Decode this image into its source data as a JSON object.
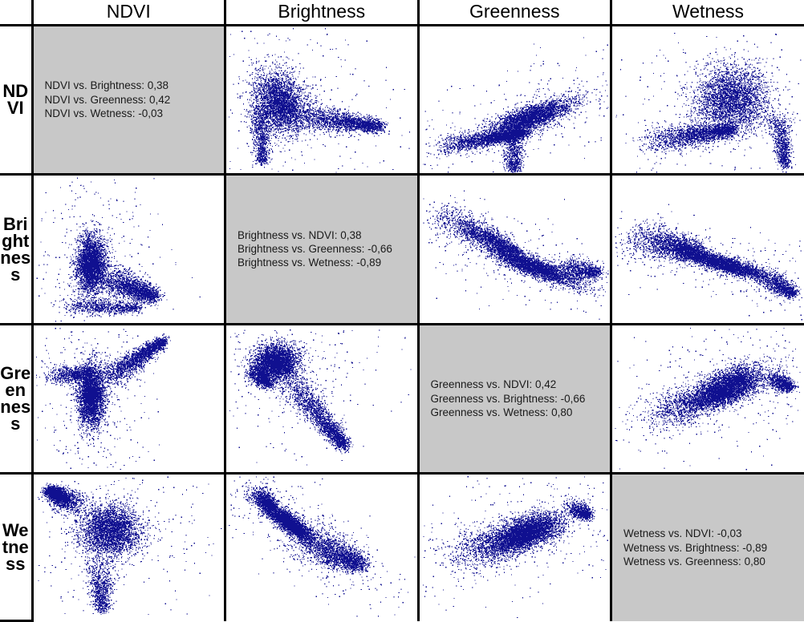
{
  "variables": [
    "NDVI",
    "Brightness",
    "Greenness",
    "Wetness"
  ],
  "column_headers": [
    {
      "label": "NDVI"
    },
    {
      "label": "Brightness"
    },
    {
      "label": "Greenness"
    },
    {
      "label": "Wetness"
    }
  ],
  "row_headers": [
    {
      "label": "NDVI"
    },
    {
      "label": "Brightness"
    },
    {
      "label": "Greenness"
    },
    {
      "label": "Wetness"
    }
  ],
  "colors": {
    "point": "#101090",
    "diagonal_background": "#c8c8c8",
    "cell_background": "#ffffff",
    "grid_line": "#000000",
    "text": "#1a1a1a",
    "stray_point": "#ff00ff"
  },
  "diagonal_panels": [
    {
      "variable": "NDVI",
      "lines": [
        "NDVI vs. Brightness: 0,38",
        "NDVI vs. Greenness: 0,42",
        "NDVI vs. Wetness: -0,03"
      ]
    },
    {
      "variable": "Brightness",
      "lines": [
        "Brightness vs. NDVI: 0,38",
        "Brightness vs. Greenness: -0,66",
        "Brightness vs. Wetness: -0,89"
      ]
    },
    {
      "variable": "Greenness",
      "lines": [
        "Greenness vs. NDVI: 0,42",
        "Greenness vs. Brightness: -0,66",
        "Greenness vs. Wetness: 0,80"
      ]
    },
    {
      "variable": "Wetness",
      "lines": [
        "Wetness vs. NDVI: -0,03",
        "Wetness vs. Brightness: -0,89",
        "Wetness vs. Greenness: 0,80"
      ]
    }
  ],
  "chart_data": {
    "type": "scatter",
    "title": "Scatter plot matrix of NDVI, Brightness, Greenness and Wetness",
    "variables": [
      "NDVI",
      "Brightness",
      "Greenness",
      "Wetness"
    ],
    "correlation_matrix": [
      [
        null,
        0.38,
        0.42,
        -0.03
      ],
      [
        0.38,
        null,
        -0.66,
        -0.89
      ],
      [
        0.42,
        -0.66,
        null,
        0.8
      ],
      [
        -0.03,
        -0.89,
        0.8,
        null
      ]
    ],
    "correlation_labels": [
      [
        "",
        "0,38",
        "0,42",
        "-0,03"
      ],
      [
        "0,38",
        "",
        "-0,66",
        "-0,89"
      ],
      [
        "0,42",
        "-0,66",
        "",
        "0,80"
      ],
      [
        "-0,03",
        "-0,89",
        "0,80",
        ""
      ]
    ],
    "grid": false,
    "legend": "none",
    "axis_ticks": "none",
    "n_points_per_panel": 6500,
    "panels": [
      {
        "row": "NDVI",
        "col": "NDVI",
        "kind": "diagonal-text"
      },
      {
        "row": "NDVI",
        "col": "Brightness",
        "kind": "scatter",
        "r": 0.38,
        "shape": "comet-left-tail-right",
        "cloud": {
          "cx": 0.28,
          "cy": 0.52,
          "rx": 0.16,
          "ry": 0.25,
          "rot": -12
        },
        "tail": {
          "x0": 0.34,
          "y0": 0.6,
          "x1": 0.8,
          "y1": 0.68,
          "spread": 0.05
        },
        "spur": {
          "x0": 0.17,
          "y0": 0.55,
          "x1": 0.19,
          "y1": 0.93,
          "spread": 0.03
        }
      },
      {
        "row": "NDVI",
        "col": "Greenness",
        "kind": "scatter",
        "r": 0.42,
        "shape": "rising-wedge",
        "cloud": {
          "cx": 0.58,
          "cy": 0.62,
          "rx": 0.3,
          "ry": 0.09,
          "rot": -26
        },
        "tail": {
          "x0": 0.1,
          "y0": 0.82,
          "x1": 0.55,
          "y1": 0.72,
          "spread": 0.035
        },
        "spur": {
          "x0": 0.5,
          "y0": 0.66,
          "x1": 0.49,
          "y1": 0.98,
          "spread": 0.035
        }
      },
      {
        "row": "NDVI",
        "col": "Wetness",
        "kind": "scatter",
        "r": -0.03,
        "shape": "dome-right-hook",
        "cloud": {
          "cx": 0.62,
          "cy": 0.5,
          "rx": 0.22,
          "ry": 0.26,
          "rot": 8
        },
        "tail": {
          "x0": 0.18,
          "y0": 0.78,
          "x1": 0.62,
          "y1": 0.7,
          "spread": 0.05
        },
        "spur": {
          "x0": 0.86,
          "y0": 0.6,
          "x1": 0.9,
          "y1": 0.95,
          "spread": 0.03
        }
      },
      {
        "row": "Brightness",
        "col": "NDVI",
        "kind": "scatter",
        "r": 0.38,
        "shape": "comet-top-tail-bottom",
        "cloud": {
          "cx": 0.3,
          "cy": 0.6,
          "rx": 0.09,
          "ry": 0.22,
          "rot": 0
        },
        "tail": {
          "x0": 0.33,
          "y0": 0.66,
          "x1": 0.62,
          "y1": 0.82,
          "spread": 0.06
        },
        "spur": {
          "x0": 0.18,
          "y0": 0.88,
          "x1": 0.55,
          "y1": 0.9,
          "spread": 0.03
        }
      },
      {
        "row": "Brightness",
        "col": "Brightness",
        "kind": "diagonal-text"
      },
      {
        "row": "Brightness",
        "col": "Greenness",
        "kind": "scatter",
        "r": -0.66,
        "shape": "descending-band",
        "cloud": {
          "cx": 0.6,
          "cy": 0.62,
          "rx": 0.3,
          "ry": 0.07,
          "rot": 26
        },
        "tail": {
          "x0": 0.1,
          "y0": 0.25,
          "x1": 0.5,
          "y1": 0.52,
          "spread": 0.05
        },
        "spur": {
          "x0": 0.75,
          "y0": 0.62,
          "x1": 0.93,
          "y1": 0.66,
          "spread": 0.04
        }
      },
      {
        "row": "Brightness",
        "col": "Wetness",
        "kind": "scatter",
        "r": -0.89,
        "shape": "descending-band-tight",
        "cloud": {
          "cx": 0.58,
          "cy": 0.6,
          "rx": 0.3,
          "ry": 0.06,
          "rot": 22
        },
        "tail": {
          "x0": 0.12,
          "y0": 0.42,
          "x1": 0.45,
          "y1": 0.52,
          "spread": 0.07
        },
        "spur": {
          "x0": 0.8,
          "y0": 0.7,
          "x1": 0.94,
          "y1": 0.8,
          "spread": 0.035
        }
      },
      {
        "row": "Greenness",
        "col": "NDVI",
        "kind": "scatter",
        "r": 0.42,
        "shape": "rising-plume",
        "cloud": {
          "cx": 0.3,
          "cy": 0.48,
          "rx": 0.08,
          "ry": 0.24,
          "rot": 0
        },
        "tail": {
          "x0": 0.34,
          "y0": 0.4,
          "x1": 0.68,
          "y1": 0.1,
          "spread": 0.04
        },
        "spur": {
          "x0": 0.1,
          "y0": 0.34,
          "x1": 0.3,
          "y1": 0.32,
          "spread": 0.035
        }
      },
      {
        "row": "Greenness",
        "col": "Brightness",
        "kind": "scatter",
        "r": -0.66,
        "shape": "descending-plume",
        "cloud": {
          "cx": 0.26,
          "cy": 0.25,
          "rx": 0.13,
          "ry": 0.14,
          "rot": 20
        },
        "tail": {
          "x0": 0.3,
          "y0": 0.32,
          "x1": 0.62,
          "y1": 0.82,
          "spread": 0.045
        },
        "spur": {
          "x0": 0.14,
          "y0": 0.3,
          "x1": 0.22,
          "y1": 0.4,
          "spread": 0.03
        }
      },
      {
        "row": "Greenness",
        "col": "Greenness",
        "kind": "diagonal-text"
      },
      {
        "row": "Greenness",
        "col": "Wetness",
        "kind": "scatter",
        "r": 0.8,
        "shape": "rising-blob",
        "cloud": {
          "cx": 0.62,
          "cy": 0.4,
          "rx": 0.22,
          "ry": 0.12,
          "rot": -28
        },
        "tail": {
          "x0": 0.22,
          "y0": 0.62,
          "x1": 0.6,
          "y1": 0.45,
          "spread": 0.07
        },
        "spur": {
          "x0": 0.84,
          "y0": 0.35,
          "x1": 0.92,
          "y1": 0.42,
          "spread": 0.03
        }
      },
      {
        "row": "Wetness",
        "col": "NDVI",
        "kind": "scatter",
        "r": -0.03,
        "shape": "dome-bottom-hook",
        "cloud": {
          "cx": 0.4,
          "cy": 0.38,
          "rx": 0.19,
          "ry": 0.2,
          "rot": -10
        },
        "tail": {
          "x0": 0.22,
          "y0": 0.22,
          "x1": 0.08,
          "y1": 0.1,
          "spread": 0.04
        },
        "spur": {
          "x0": 0.34,
          "y0": 0.58,
          "x1": 0.36,
          "y1": 0.92,
          "spread": 0.04
        }
      },
      {
        "row": "Wetness",
        "col": "Brightness",
        "kind": "scatter",
        "r": -0.89,
        "shape": "descending-band-tight-2",
        "cloud": {
          "cx": 0.32,
          "cy": 0.32,
          "rx": 0.22,
          "ry": 0.06,
          "rot": 44
        },
        "tail": {
          "x0": 0.38,
          "y0": 0.42,
          "x1": 0.7,
          "y1": 0.62,
          "spread": 0.07
        },
        "spur": {
          "x0": 0.16,
          "y0": 0.12,
          "x1": 0.24,
          "y1": 0.22,
          "spread": 0.03
        }
      },
      {
        "row": "Wetness",
        "col": "Greenness",
        "kind": "scatter",
        "r": 0.8,
        "shape": "rising-blob-2",
        "cloud": {
          "cx": 0.58,
          "cy": 0.38,
          "rx": 0.22,
          "ry": 0.12,
          "rot": -22
        },
        "tail": {
          "x0": 0.22,
          "y0": 0.55,
          "x1": 0.55,
          "y1": 0.42,
          "spread": 0.08
        },
        "spur": {
          "x0": 0.8,
          "y0": 0.22,
          "x1": 0.88,
          "y1": 0.28,
          "spread": 0.03
        }
      },
      {
        "row": "Wetness",
        "col": "Wetness",
        "kind": "diagonal-text"
      }
    ]
  }
}
